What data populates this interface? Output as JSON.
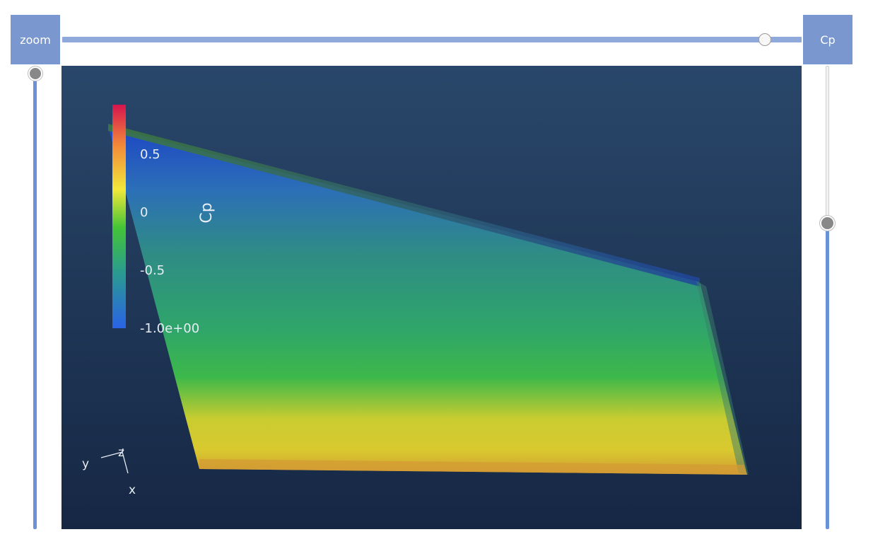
{
  "controls": {
    "zoom_label": "zoom",
    "cp_label": "Cp",
    "horizontal_slider_value": 0.95,
    "zoom_slider_value": 1.0,
    "cp_slider_value": 0.66
  },
  "colorbar": {
    "title": "Cp",
    "ticks": [
      "0.5",
      "0",
      "-0.5",
      "-1.0e+00"
    ]
  },
  "axes_triad": {
    "y_label": "y",
    "z_label": "z",
    "x_label": "x"
  },
  "colors": {
    "button": "#7a98cf",
    "slider_fill": "#6b92d6",
    "viewport_bg_top": "#29476a",
    "viewport_bg_bottom": "#162744"
  }
}
